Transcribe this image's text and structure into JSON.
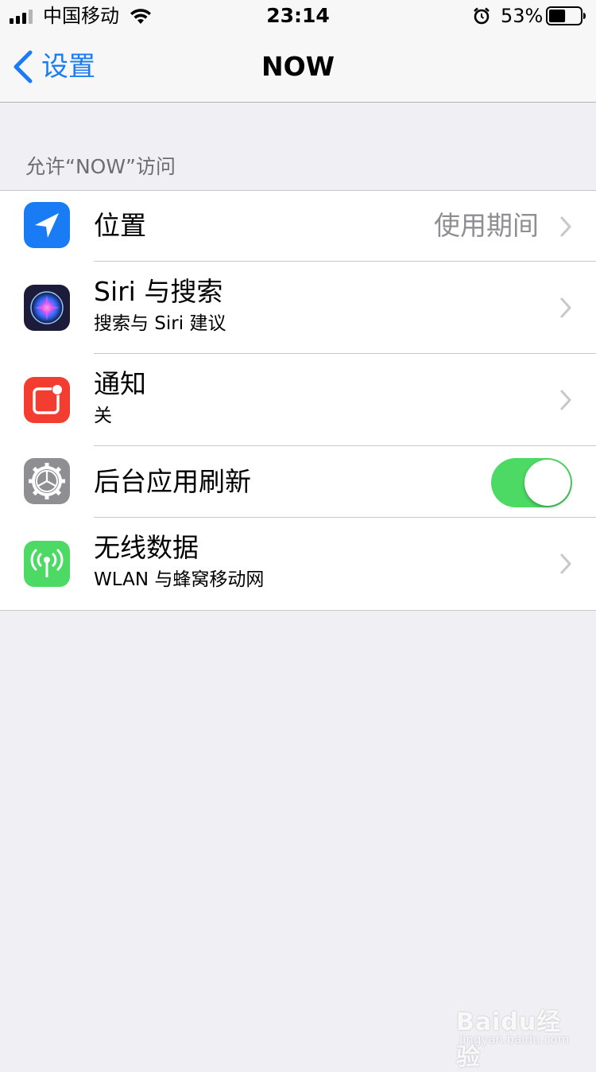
{
  "status_bar": {
    "carrier": "中国移动",
    "time": "23:14",
    "battery_percent": "53%",
    "battery_level": 0.53,
    "icons": [
      "signal-icon",
      "wifi-icon",
      "alarm-icon",
      "battery-icon"
    ]
  },
  "nav": {
    "back_label": "设置",
    "title": "NOW"
  },
  "section": {
    "header": "允许“NOW”访问"
  },
  "rows": [
    {
      "title": "位置",
      "value": "使用期间",
      "icon": "location-arrow-icon",
      "icon_color": "#1a7cf5"
    },
    {
      "title": "Siri 与搜索",
      "subtitle": "搜索与 Siri 建议",
      "icon": "siri-icon",
      "icon_color": "#1c1c3a"
    },
    {
      "title": "通知",
      "subtitle": "关",
      "icon": "notifications-icon",
      "icon_color": "#f23d30"
    },
    {
      "title": "后台应用刷新",
      "icon": "gear-icon",
      "icon_color": "#8e8e93",
      "toggle_on": true
    },
    {
      "title": "无线数据",
      "subtitle": "WLAN 与蜂窝移动网",
      "icon": "antenna-icon",
      "icon_color": "#4cd964"
    }
  ],
  "colors": {
    "accent": "#1a7cf5",
    "toggle_on": "#4cd964",
    "background": "#efeff4"
  },
  "watermark": {
    "logo_text": "Baidu经验",
    "url": "jingyan.baidu.com"
  }
}
